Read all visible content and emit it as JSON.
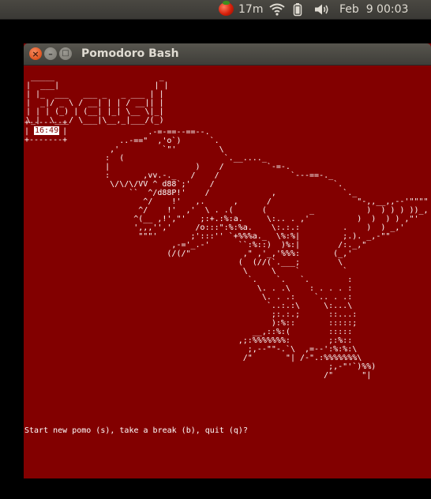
{
  "top_panel": {
    "tomato_icon": "tomato-icon",
    "tomato_time": "17m",
    "network_icon": "wifi-icon",
    "battery_icon": "battery-icon",
    "sound_icon": "speaker-icon",
    "clock": "Feb  9 00:03"
  },
  "window": {
    "title": "Pomodoro Bash",
    "close_glyph": "×",
    "minimize_glyph": "–",
    "maximize_glyph": "□"
  },
  "terminal": {
    "background": "#820000",
    "focus_banner": " _____                      _ \n|  ___|                    | |\n| |_  ___   ___ _   _ ___ | |\n|  _|/ _ \\ / __| | | / __|| |\n| | | (_) | (__| |_| \\__ \\|_|\n\\_|  \\___/ \\___|\\__,_|___/(_)",
    "timer_box": "+-------+\n|       |\n+-------+",
    "timer": "16:49",
    "dinosaur": "                .-=-==--==--.\n          ..-==\"  ,'o`)      `.\n        ,'         `\"'         \\\n       :  (                     `.__...._\n       |                  )    /         `-=-.\n       :       ,vv.-._   /    /               `---==-._\n        \\/\\/\\/VV ^ d88`;'    /                         `.\n            ``  ^/d88P!'    /             ,              `._\n               ^/    !'   ,.      ,      /                  \"-,,__,,--'\"\"\"\"-.\n              ^/    !'  ,'  \\ . .(      (         _           )  ) ) ) ))_,-.\\\n             ^(__ ,!',\"'   ;:+.:%:a.     \\:.. . ,'          )  )  ) ) ,\"'    '\n             ',,,'','     /o:::\":%:%a.    \\:.:.:         .    )  ) _,'\n              \"\"\"'       ;':::'' `+%%%a._  \\%:%|         ;.). _,-\"\"\n                     ,-='_.-'      ``:%::)  )%:|        /:._,\"\n                    (/(/\"           ,\" ,'_,'%%%:       (_,'\n                                   (  (//(`.___;        \\\n                                    \\     \\    `         `\n                                     `.    `.   `.        :\n                                       \\. . .\\    : . . . :\n                                        \\. . .:    `.. . .:\n                                         `..:.:\\     \\:...\\\n                                          ;:.:.;      ::...:\n                                          ):%::       :::::;\n                                      __,::%:(        :::::\n                                   ,;:%%%%%%%:        ;:%::\n                                     ;,--\"\"-.`\\  ,=--':%:%:\\\n                                    /\"       \"| /-\".:%%%%%%%\\\n                                                      ;,-\"'`)%%)\n                                                     /\"      \"|",
    "prompt": "Start new pomo (s), take a break (b), quit (q)?"
  }
}
